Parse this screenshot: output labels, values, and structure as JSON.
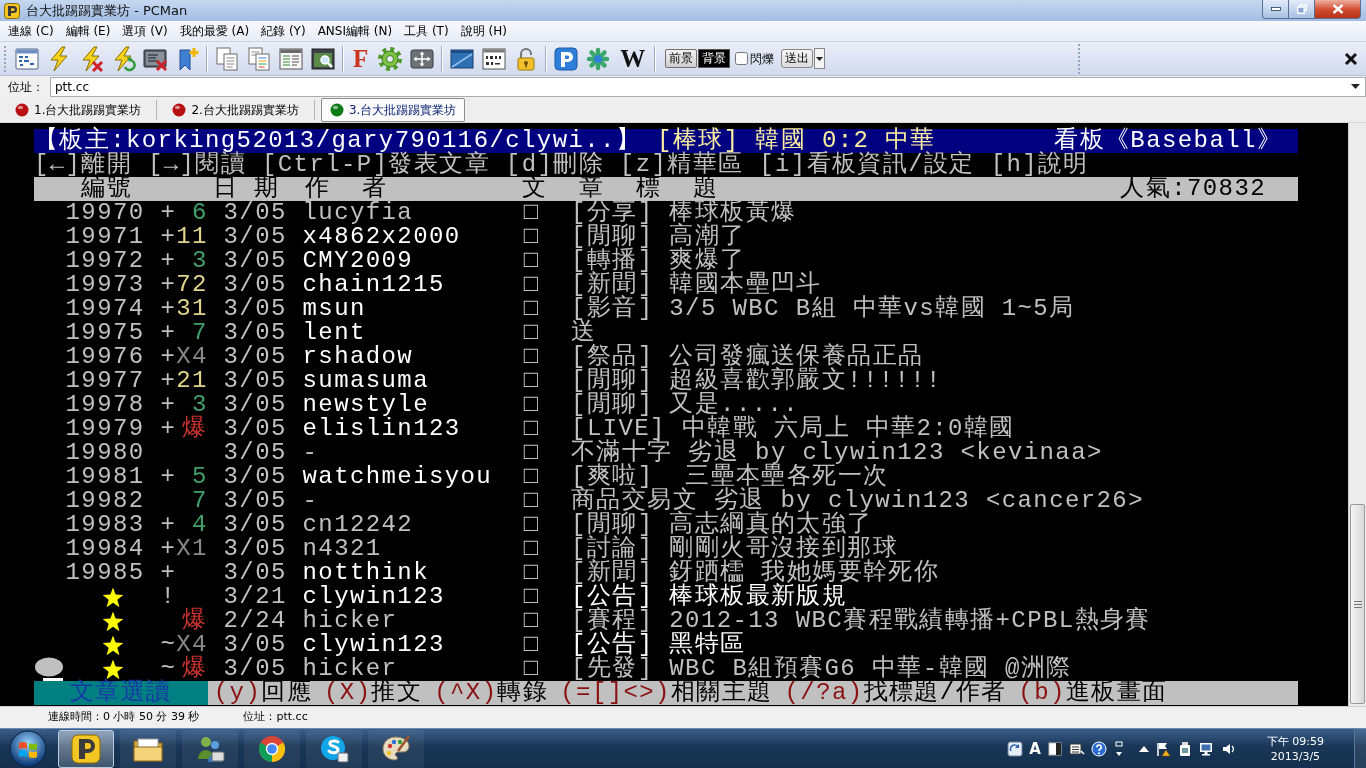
{
  "window": {
    "title": "台大批踢踢實業坊 - PCMan"
  },
  "menu": [
    "連線 (C)",
    "編輯 (E)",
    "選項 (V)",
    "我的最愛 (A)",
    "紀錄 (Y)",
    "ANSI編輯 (N)",
    "工具 (T)",
    "說明 (H)"
  ],
  "toolbar": {
    "letter_buttons": [
      {
        "text": "F",
        "color": "#c8341c"
      },
      {
        "text": "W",
        "color": "#111111"
      }
    ],
    "foreground_button": "前景",
    "background_button": "背景",
    "blink": {
      "label": "閃爍",
      "checked": false
    },
    "send_button": "送出"
  },
  "address": {
    "label": "位址：",
    "value": "ptt.cc"
  },
  "tabs": [
    {
      "label": "1.台大批踢踢實業坊",
      "selected": false,
      "color": "#b81010"
    },
    {
      "label": "2.台大批踢踢實業坊",
      "selected": false,
      "color": "#b81010"
    },
    {
      "label": "3.台大批踢踢實業坊",
      "selected": true,
      "color": "#0c7a14"
    }
  ],
  "terminal": {
    "board_header": {
      "moderators": "【板主:korking52013/gary790116/clywi..】",
      "title": "[棒球] 韓國 0:2 中華",
      "board": "看板《Baseball》"
    },
    "help_line": "[←]離開 [→]閱讀 [Ctrl-P]發表文章 [d]刪除 [z]精華區 [i]看板資訊/設定 [h]說明",
    "column_header": {
      "columns": [
        "編號",
        "日 期",
        "作  者",
        "文  章  標  題"
      ],
      "popularity": "人氣:70832"
    },
    "posts": [
      {
        "kind": "post",
        "number": "19970",
        "mark": "+",
        "push": {
          "text": "6",
          "color": "#3fa06a"
        },
        "date": "3/05",
        "author": {
          "text": "lucyfia",
          "bright": false
        },
        "type": "□",
        "title": {
          "text": "[分享] 棒球板黃爆",
          "bright": false
        },
        "selected": false
      },
      {
        "kind": "post",
        "number": "19971",
        "mark": "+",
        "push": {
          "text": "11",
          "color": "#e0d48a"
        },
        "date": "3/05",
        "author": {
          "text": "x4862x2000",
          "bright": true
        },
        "type": "□",
        "title": {
          "text": "[閒聊] 高潮了",
          "bright": false
        },
        "selected": false
      },
      {
        "kind": "post",
        "number": "19972",
        "mark": "+",
        "push": {
          "text": "3",
          "color": "#3fa06a"
        },
        "date": "3/05",
        "author": {
          "text": "CMY2009",
          "bright": true
        },
        "type": "□",
        "title": {
          "text": "[轉播] 爽爆了",
          "bright": false
        },
        "selected": false
      },
      {
        "kind": "post",
        "number": "19973",
        "mark": "+",
        "push": {
          "text": "72",
          "color": "#e0d48a"
        },
        "date": "3/05",
        "author": {
          "text": "chain1215",
          "bright": true
        },
        "type": "□",
        "title": {
          "text": "[新聞] 韓國本壘凹斗",
          "bright": false
        },
        "selected": false
      },
      {
        "kind": "post",
        "number": "19974",
        "mark": "+",
        "push": {
          "text": "31",
          "color": "#e0d48a"
        },
        "date": "3/05",
        "author": {
          "text": "msun",
          "bright": true
        },
        "type": "□",
        "title": {
          "text": "[影音] 3/5 WBC B組 中華vs韓國 1~5局",
          "bright": false
        },
        "selected": false
      },
      {
        "kind": "post",
        "number": "19975",
        "mark": "+",
        "push": {
          "text": "7",
          "color": "#3fa06a"
        },
        "date": "3/05",
        "author": {
          "text": "lent",
          "bright": true
        },
        "type": "□",
        "title": {
          "text": "送",
          "bright": false
        },
        "selected": false
      },
      {
        "kind": "post",
        "number": "19976",
        "mark": "+",
        "push": {
          "text": "X4",
          "color": "#8a8a8a"
        },
        "date": "3/05",
        "author": {
          "text": "rshadow",
          "bright": true
        },
        "type": "□",
        "title": {
          "text": "[祭品] 公司發瘋送保養品正品",
          "bright": false
        },
        "selected": false
      },
      {
        "kind": "post",
        "number": "19977",
        "mark": "+",
        "push": {
          "text": "21",
          "color": "#e0d48a"
        },
        "date": "3/05",
        "author": {
          "text": "sumasuma",
          "bright": true
        },
        "type": "□",
        "title": {
          "text": "[閒聊] 超級喜歡郭嚴文!!!!!!",
          "bright": false
        },
        "selected": false
      },
      {
        "kind": "post",
        "number": "19978",
        "mark": "+",
        "push": {
          "text": "3",
          "color": "#3fa06a"
        },
        "date": "3/05",
        "author": {
          "text": "newstyle",
          "bright": true
        },
        "type": "□",
        "title": {
          "text": "[閒聊] 又是.....",
          "bright": false
        },
        "selected": false
      },
      {
        "kind": "post",
        "number": "19979",
        "mark": "+",
        "push": {
          "text": "爆",
          "color": "#c8322d"
        },
        "date": "3/05",
        "author": {
          "text": "elislin123",
          "bright": true
        },
        "type": "□",
        "title": {
          "text": "[LIVE] 中韓戰 六局上 中華2:0韓國",
          "bright": false
        },
        "selected": false
      },
      {
        "kind": "post",
        "number": "19980",
        "date": "3/05",
        "author": {
          "text": "-",
          "bright": false
        },
        "type": "□",
        "title": {
          "text": "不滿十字 劣退 by clywin123 <kevinaa>",
          "bright": false
        },
        "selected": false
      },
      {
        "kind": "post",
        "number": "19981",
        "mark": "+",
        "push": {
          "text": "5",
          "color": "#3fa06a"
        },
        "date": "3/05",
        "author": {
          "text": "watchmeisyou",
          "bright": true
        },
        "type": "□",
        "title": {
          "text": "[爽啦]  三壘本壘各死一次",
          "bright": false
        },
        "selected": false
      },
      {
        "kind": "post",
        "number": "19982",
        "push": {
          "text": "7",
          "color": "#3fa06a"
        },
        "date": "3/05",
        "author": {
          "text": "-",
          "bright": false
        },
        "type": "□",
        "title": {
          "text": "商品交易文 劣退 by clywin123 <cancer26>",
          "bright": false
        },
        "selected": false
      },
      {
        "kind": "post",
        "number": "19983",
        "mark": "+",
        "push": {
          "text": "4",
          "color": "#3fa06a"
        },
        "date": "3/05",
        "author": {
          "text": "cn12242",
          "bright": false
        },
        "type": "□",
        "title": {
          "text": "[閒聊] 高志綱真的太強了",
          "bright": false
        },
        "selected": false
      },
      {
        "kind": "post",
        "number": "19984",
        "mark": "+",
        "push": {
          "text": "X1",
          "color": "#8a8a8a"
        },
        "date": "3/05",
        "author": {
          "text": "n4321",
          "bright": false
        },
        "type": "□",
        "title": {
          "text": "[討論] 剛剛火哥沒接到那球",
          "bright": false
        },
        "selected": false
      },
      {
        "kind": "post",
        "number": "19985",
        "mark": "+",
        "date": "3/05",
        "author": {
          "text": "notthink",
          "bright": true
        },
        "type": "□",
        "title": {
          "text": "[新聞] 釾跴櫺 我她媽要幹死你",
          "bright": false
        },
        "selected": false
      },
      {
        "kind": "pinned",
        "mark": "!",
        "date": "3/21",
        "author": {
          "text": "clywin123",
          "bright": true
        },
        "type": "□",
        "title": {
          "text": "[公告] 棒球板最新版規",
          "bright": true
        },
        "selected": false
      },
      {
        "kind": "pinned",
        "push": {
          "text": "爆",
          "color": "#c8322d"
        },
        "date": "2/24",
        "author": {
          "text": "hicker",
          "bright": false
        },
        "type": "□",
        "title": {
          "text": "[賽程] 2012-13 WBC賽程戰績轉播+CPBL熱身賽",
          "bright": false
        },
        "selected": false
      },
      {
        "kind": "pinned",
        "mark": "~",
        "push": {
          "text": "X4",
          "color": "#8a8a8a"
        },
        "date": "3/05",
        "author": {
          "text": "clywin123",
          "bright": true
        },
        "type": "□",
        "title": {
          "text": "[公告] 黑特區",
          "bright": true
        },
        "selected": false
      },
      {
        "kind": "pinned",
        "mark": "~",
        "push": {
          "text": "爆",
          "color": "#c8322d"
        },
        "date": "3/05",
        "author": {
          "text": "hicker",
          "bright": false
        },
        "type": "□",
        "title": {
          "text": "[先發] WBC B組預賽G6 中華-韓國 @洲際",
          "bright": false
        },
        "selected": true
      }
    ],
    "footer": {
      "mode": "文章選讀",
      "hints": [
        {
          "key": "(y)",
          "label": "回應"
        },
        {
          "key": "(X)",
          "label": "推文"
        },
        {
          "key": "(^X)",
          "label": "轉錄"
        },
        {
          "key": "(=[]<>)",
          "label": "相關主題"
        },
        {
          "key": "(/?a)",
          "label": "找標題/作者"
        },
        {
          "key": "(b)",
          "label": "進板畫面"
        }
      ]
    }
  },
  "status_bar": {
    "connection_time": "連線時間：0 小時 50 分 39 秒",
    "address": "位址：ptt.cc"
  },
  "taskbar": {
    "buttons": [
      {
        "kind": "logo",
        "selected": true
      },
      {
        "kind": "folder",
        "selected": false
      },
      {
        "kind": "people",
        "selected": false
      },
      {
        "kind": "browser",
        "selected": false
      },
      {
        "kind": "chat",
        "selected": false
      },
      {
        "kind": "palette",
        "selected": false
      }
    ],
    "ime_indicator": "A",
    "clock": {
      "time": "下午 09:59",
      "date": "2013/3/5"
    }
  }
}
